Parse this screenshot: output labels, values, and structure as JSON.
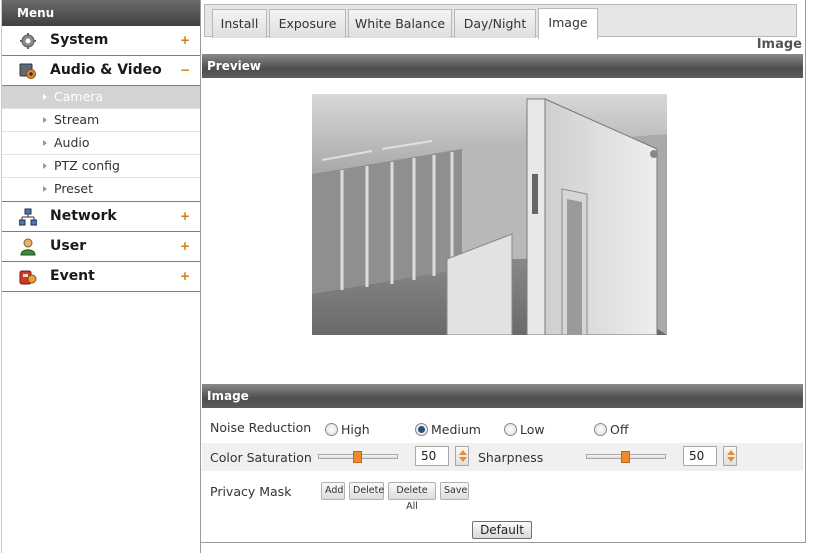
{
  "sidebar": {
    "title": "Menu",
    "items": [
      {
        "label": "System",
        "toggle": "+",
        "icon": "gear-icon"
      },
      {
        "label": "Audio & Video",
        "toggle": "−",
        "icon": "camera-icon"
      },
      {
        "label": "Network",
        "toggle": "+",
        "icon": "network-icon"
      },
      {
        "label": "User",
        "toggle": "+",
        "icon": "user-icon"
      },
      {
        "label": "Event",
        "toggle": "+",
        "icon": "alarm-icon"
      }
    ],
    "submenu": [
      "Camera",
      "Stream",
      "Audio",
      "PTZ config",
      "Preset"
    ],
    "active_submenu": "Camera"
  },
  "tabs": [
    "Install",
    "Exposure",
    "White Balance",
    "Day/Night",
    "Image"
  ],
  "active_tab": "Image",
  "page_heading": "Image",
  "preview": {
    "title": "Preview"
  },
  "image_section": {
    "title": "Image",
    "noise_reduction": {
      "label": "Noise Reduction",
      "options": [
        "High",
        "Medium",
        "Low",
        "Off"
      ],
      "selected": "Medium"
    },
    "color_saturation": {
      "label": "Color Saturation",
      "value": "50"
    },
    "sharpness": {
      "label": "Sharpness",
      "value": "50"
    },
    "privacy_mask": {
      "label": "Privacy Mask",
      "buttons": [
        "Add",
        "Delete",
        "Delete All",
        "Save"
      ]
    },
    "default_button": "Default"
  },
  "colors": {
    "accent": "#f08a28",
    "section_bar": "#5c5c5c"
  }
}
